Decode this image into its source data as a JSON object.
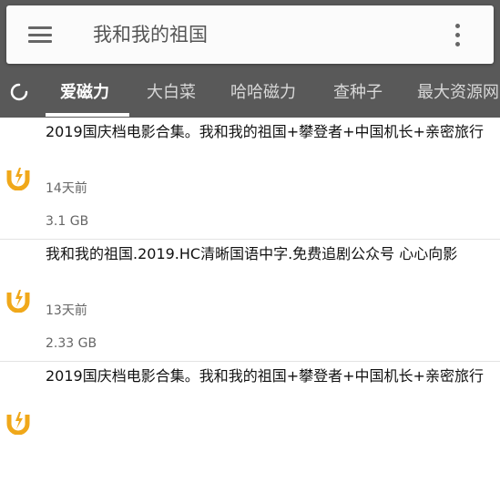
{
  "search": {
    "query": "我和我的祖国"
  },
  "tabs": [
    {
      "label": "爱磁力"
    },
    {
      "label": "大白菜"
    },
    {
      "label": "哈哈磁力"
    },
    {
      "label": "查种子"
    },
    {
      "label": "最大资源网"
    }
  ],
  "results": [
    {
      "title": "2019国庆档电影合集。我和我的祖国+攀登者+中国机长+亲密旅行",
      "age": "14天前",
      "size": "3.1 GB"
    },
    {
      "title": "我和我的祖国.2019.HC清晰国语中字.免费追剧公众号 心心向影",
      "age": "13天前",
      "size": "2.33 GB"
    },
    {
      "title": "2019国庆档电影合集。我和我的祖国+攀登者+中国机长+亲密旅行",
      "age": "",
      "size": ""
    }
  ],
  "colors": {
    "toolbar": "#595959",
    "magnet_icon": "#f0a81a"
  },
  "icons": [
    "menu-icon",
    "more-vert-icon",
    "loading-spinner-icon",
    "magnet-icon"
  ]
}
